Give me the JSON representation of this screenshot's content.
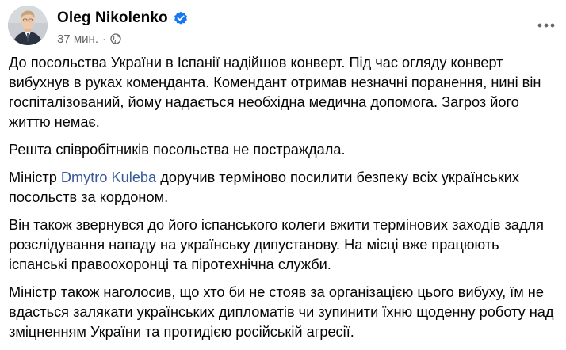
{
  "post": {
    "author": "Oleg Nikolenko",
    "time": "37 мин.",
    "paragraphs": [
      {
        "text": "До посольства України в Іспанії надійшов конверт. Під час огляду конверт вибухнув в руках коменданта. Комендант отримав незначні поранення, нині він госпіталізований, йому надається необхідна медична допомога. Загроз його життю немає."
      },
      {
        "text": "Решта співробітників посольства не постраждала."
      },
      {
        "before": "Міністр ",
        "mention": "Dmytro Kuleba",
        "after": " доручив терміново посилити безпеку всіх українських посольств за кордоном."
      },
      {
        "text": "Він також звернувся до його іспанського колеги вжити термінових заходів задля розслідування нападу на українську дипустанову. На місці вже працюють іспанські правоохоронці та піротехнічна служби."
      },
      {
        "text": "Міністр також наголосив, що хто би не стояв за організацією цього вибуху, їм не вдасться залякати українських дипломатів чи зупинити їхню щоденну роботу над зміцненням України та протидією російській агресії."
      }
    ]
  },
  "icons": {
    "verified": "verified-badge-icon",
    "audience": "globe-icon",
    "more": "more-horizontal-icon"
  },
  "colors": {
    "text": "#050505",
    "meta": "#65676b",
    "mention": "#385898",
    "verified": "#1877f2"
  }
}
